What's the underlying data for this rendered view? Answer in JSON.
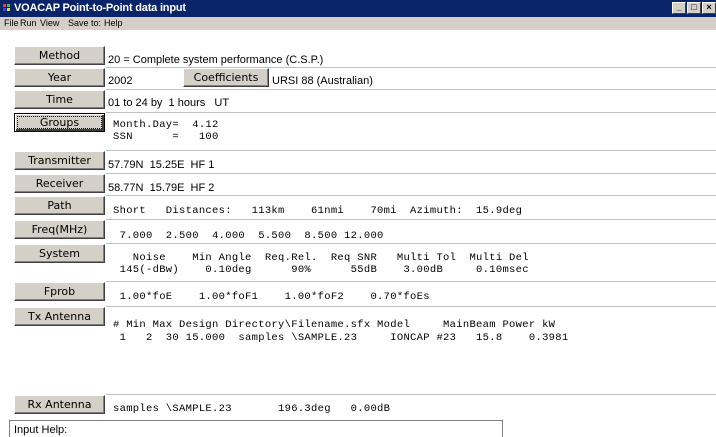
{
  "window": {
    "title": "VOACAP Point-to-Point data input",
    "controls": {
      "minimize": "_",
      "maximize": "□",
      "close": "×"
    }
  },
  "menu": [
    "File",
    "Run",
    "View",
    "Save to:",
    "Help"
  ],
  "buttons": {
    "method": "Method",
    "year": "Year",
    "time": "Time",
    "groups": "Groups",
    "transmitter": "Transmitter",
    "receiver": "Receiver",
    "path": "Path",
    "freq": "Freq(MHz)",
    "system": "System",
    "fprob": "Fprob",
    "tx_antenna": "Tx Antenna",
    "rx_antenna": "Rx Antenna",
    "coefficients": "Coefficients"
  },
  "values": {
    "method": "20 = Complete system performance (C.S.P.)",
    "year": "2002",
    "coefficients_desc": "URSI 88 (Australian)",
    "time": "01 to 24 by  1 hours   UT",
    "groups_line1": "Month.Day=  4.12",
    "groups_line2": "SSN      =   100",
    "transmitter": "57.79N  15.25E  HF 1",
    "receiver": "58.77N  15.79E  HF 2",
    "path": "Short   Distances:   113km    61nmi    70mi  Azimuth:  15.9deg",
    "freq": " 7.000  2.500  4.000  5.500  8.500 12.000",
    "system_header": "   Noise    Min Angle  Req.Rel.  Req SNR   Multi Tol  Multi Del",
    "system_values": " 145(-dBw)    0.10deg      90%      55dB    3.00dB     0.10msec",
    "fprob": " 1.00*foE    1.00*foF1    1.00*foF2    0.70*foEs",
    "tx_header": "# Min Max Design Directory\\Filename.sfx Model     MainBeam Power kW",
    "tx_row": " 1   2  30 15.000  samples \\SAMPLE.23     IONCAP #23   15.8    0.3981",
    "rx": "samples \\SAMPLE.23       196.3deg   0.00dB"
  },
  "help": {
    "label": "Input Help:"
  }
}
